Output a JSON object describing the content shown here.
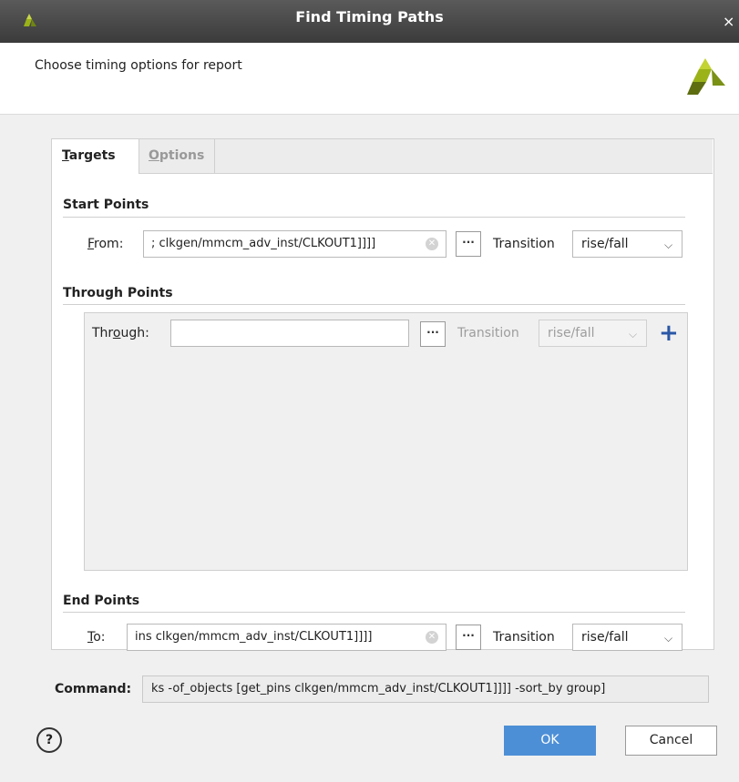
{
  "window": {
    "title": "Find Timing Paths",
    "close_glyph": "×"
  },
  "header": {
    "description": "Choose timing options for report"
  },
  "tabs": [
    {
      "label": "Targets",
      "mnemonic": "T",
      "rest": "argets",
      "active": true
    },
    {
      "label": "Options",
      "mnemonic": "O",
      "rest": "ptions",
      "active": false
    }
  ],
  "start_points": {
    "title": "Start Points",
    "from_label": "From:",
    "from_mnemonic": "F",
    "from_rest": "rom:",
    "from_value": "; clkgen/mmcm_adv_inst/CLKOUT1]]]]",
    "browse_label": "···",
    "transition_label": "Transition",
    "transition_value": "rise/fall"
  },
  "through_points": {
    "title": "Through Points",
    "through_label": "Through:",
    "through_prefix": "Thr",
    "through_mnemonic": "o",
    "through_suffix": "ugh:",
    "through_value": "",
    "browse_label": "···",
    "transition_label": "Transition",
    "transition_value": "rise/fall",
    "add_label": "+"
  },
  "end_points": {
    "title": "End Points",
    "to_label": "To:",
    "to_mnemonic": "T",
    "to_rest": "o:",
    "to_value": "ins clkgen/mmcm_adv_inst/CLKOUT1]]]]",
    "browse_label": "···",
    "transition_label": "Transition",
    "transition_value": "rise/fall"
  },
  "command": {
    "label": "Command:",
    "value": "ks -of_objects [get_pins clkgen/mmcm_adv_inst/CLKOUT1]]]] -sort_by group]"
  },
  "footer": {
    "help_label": "?",
    "ok_label": "OK",
    "cancel_label": "Cancel"
  },
  "colors": {
    "accent": "#4d8fd6",
    "add_icon": "#2a57a6",
    "logo_primary": "#9bb318",
    "logo_dark": "#5d6d10"
  },
  "icons": [
    "clear-icon",
    "ellipsis-icon",
    "chevron-down-icon",
    "plus-icon",
    "help-icon",
    "close-icon",
    "xilinx-logo-icon"
  ]
}
